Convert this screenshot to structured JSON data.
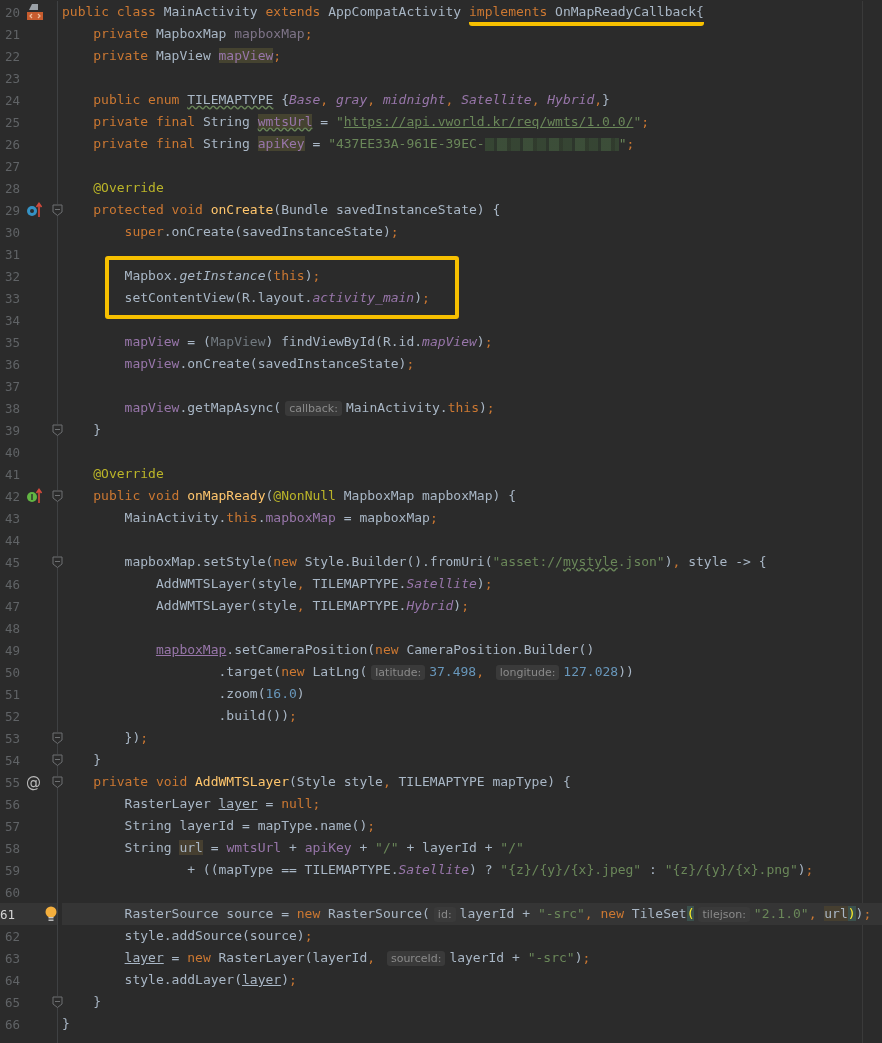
{
  "editor": {
    "lines": [
      {
        "number": "20",
        "gutter": {
          "kind": "file"
        },
        "tokens": [
          {
            "kind": "kw",
            "text": "public class "
          },
          {
            "kind": "plain",
            "text": "MainActivity "
          },
          {
            "kind": "kw",
            "text": "extends "
          },
          {
            "kind": "plain",
            "text": "AppCompatActivity "
          },
          {
            "kind": "marked",
            "tokens": [
              {
                "kind": "kw",
                "text": "implements"
              },
              {
                "kind": "plain",
                "text": " OnMapReadyCallback{"
              }
            ]
          }
        ],
        "children": [
          {
            "number": "21",
            "tokens": [
              {
                "kind": "kw",
                "text": "private "
              },
              {
                "kind": "plain",
                "text": "MapboxMap "
              },
              {
                "kind": "unused",
                "text": "mapboxMap"
              },
              {
                "kind": "kw",
                "text": ";"
              }
            ]
          },
          {
            "number": "22",
            "tokens": [
              {
                "kind": "kw",
                "text": "private "
              },
              {
                "kind": "plain",
                "text": "MapView "
              },
              {
                "kind": "fieldbg",
                "text": "mapView"
              },
              {
                "kind": "kw",
                "text": ";"
              }
            ]
          },
          {
            "number": "23"
          },
          {
            "number": "24",
            "tokens": [
              {
                "kind": "kw",
                "text": "public enum "
              },
              {
                "kind": "wavy",
                "text": "TILEMAPTYPE"
              },
              {
                "kind": "plain",
                "text": " {"
              },
              {
                "kind": "field_i",
                "text": "Base"
              },
              {
                "kind": "kw",
                "text": ", "
              },
              {
                "kind": "field_i",
                "text": "gray"
              },
              {
                "kind": "kw",
                "text": ", "
              },
              {
                "kind": "field_i",
                "text": "midnight"
              },
              {
                "kind": "kw",
                "text": ", "
              },
              {
                "kind": "field_i",
                "text": "Satellite"
              },
              {
                "kind": "kw",
                "text": ", "
              },
              {
                "kind": "field_i",
                "text": "Hybrid"
              },
              {
                "kind": "kw",
                "text": ","
              },
              {
                "kind": "plain",
                "text": "}"
              }
            ]
          },
          {
            "number": "25",
            "tokens": [
              {
                "kind": "kw",
                "text": "private final "
              },
              {
                "kind": "plain",
                "text": "String "
              },
              {
                "kind": "fieldbg_wavy",
                "text": "wmtsUrl"
              },
              {
                "kind": "plain",
                "text": " = "
              },
              {
                "kind": "str",
                "text": "\""
              },
              {
                "kind": "strurl",
                "text": "https://api.vworld.kr/req/wmts/1.0.0/"
              },
              {
                "kind": "str",
                "text": "\""
              },
              {
                "kind": "kw",
                "text": ";"
              }
            ]
          },
          {
            "number": "26",
            "tokens": [
              {
                "kind": "kw",
                "text": "private final "
              },
              {
                "kind": "plain",
                "text": "String "
              },
              {
                "kind": "fieldbg",
                "text": "apiKey"
              },
              {
                "kind": "plain",
                "text": " = "
              },
              {
                "kind": "str",
                "text": "\"437EE33A-961E-39EC-"
              },
              {
                "kind": "redacted"
              },
              {
                "kind": "str",
                "text": "\""
              },
              {
                "kind": "kw",
                "text": ";"
              }
            ]
          },
          {
            "number": "27"
          },
          {
            "number": "28",
            "tokens": [
              {
                "kind": "ann",
                "text": "@Override"
              }
            ]
          },
          {
            "number": "29",
            "gutter": {
              "kind": "override"
            },
            "fold": true,
            "tokens": [
              {
                "kind": "kw",
                "text": "protected void "
              },
              {
                "kind": "fn",
                "text": "onCreate"
              },
              {
                "kind": "plain",
                "text": "(Bundle savedInstanceState) {"
              }
            ],
            "children": [
              {
                "number": "30",
                "tokens": [
                  {
                    "kind": "kw",
                    "text": "super"
                  },
                  {
                    "kind": "plain",
                    "text": ".onCreate(savedInstanceState)"
                  },
                  {
                    "kind": "kw",
                    "text": ";"
                  }
                ]
              },
              {
                "number": "31"
              },
              {
                "number": "32",
                "boxed": true,
                "tokens": [
                  {
                    "kind": "plain",
                    "text": "Mapbox."
                  },
                  {
                    "kind": "static_i",
                    "text": "getInstance"
                  },
                  {
                    "kind": "plain",
                    "text": "("
                  },
                  {
                    "kind": "kw",
                    "text": "this"
                  },
                  {
                    "kind": "plain",
                    "text": ")"
                  },
                  {
                    "kind": "kw",
                    "text": ";"
                  }
                ]
              },
              {
                "number": "33",
                "boxed": true,
                "tokens": [
                  {
                    "kind": "plain",
                    "text": "setContentView(R.layout."
                  },
                  {
                    "kind": "field_i",
                    "text": "activity_main"
                  },
                  {
                    "kind": "plain",
                    "text": ")"
                  },
                  {
                    "kind": "kw",
                    "text": ";"
                  }
                ]
              },
              {
                "number": "34"
              },
              {
                "number": "35",
                "tokens": [
                  {
                    "kind": "field",
                    "text": "mapView"
                  },
                  {
                    "kind": "plain",
                    "text": " = ("
                  },
                  {
                    "kind": "gray",
                    "text": "MapView"
                  },
                  {
                    "kind": "plain",
                    "text": ") findViewById(R.id."
                  },
                  {
                    "kind": "field_i",
                    "text": "mapView"
                  },
                  {
                    "kind": "plain",
                    "text": ")"
                  },
                  {
                    "kind": "kw",
                    "text": ";"
                  }
                ]
              },
              {
                "number": "36",
                "tokens": [
                  {
                    "kind": "field",
                    "text": "mapView"
                  },
                  {
                    "kind": "plain",
                    "text": ".onCreate(savedInstanceState)"
                  },
                  {
                    "kind": "kw",
                    "text": ";"
                  }
                ]
              },
              {
                "number": "37"
              },
              {
                "number": "38",
                "tokens": [
                  {
                    "kind": "field",
                    "text": "mapView"
                  },
                  {
                    "kind": "plain",
                    "text": ".getMapAsync("
                  },
                  {
                    "kind": "hint",
                    "text": "callback:"
                  },
                  {
                    "kind": "plain",
                    "text": "MainActivity."
                  },
                  {
                    "kind": "kw",
                    "text": "this"
                  },
                  {
                    "kind": "plain",
                    "text": ")"
                  },
                  {
                    "kind": "kw",
                    "text": ";"
                  }
                ]
              }
            ]
          },
          {
            "number": "39",
            "fold": true,
            "tokens": [
              {
                "kind": "plain",
                "text": "}"
              }
            ]
          },
          {
            "number": "40"
          },
          {
            "number": "41",
            "tokens": [
              {
                "kind": "ann",
                "text": "@Override"
              }
            ]
          },
          {
            "number": "42",
            "gutter": {
              "kind": "implement"
            },
            "fold": true,
            "tokens": [
              {
                "kind": "kw",
                "text": "public void "
              },
              {
                "kind": "fn",
                "text": "onMapReady"
              },
              {
                "kind": "plain",
                "text": "("
              },
              {
                "kind": "ann",
                "text": "@NonNull"
              },
              {
                "kind": "plain",
                "text": " MapboxMap mapboxMap) {"
              }
            ],
            "children": [
              {
                "number": "43",
                "tokens": [
                  {
                    "kind": "plain",
                    "text": "MainActivity."
                  },
                  {
                    "kind": "kw",
                    "text": "this"
                  },
                  {
                    "kind": "plain",
                    "text": "."
                  },
                  {
                    "kind": "field",
                    "text": "mapboxMap"
                  },
                  {
                    "kind": "plain",
                    "text": " = mapboxMap"
                  },
                  {
                    "kind": "kw",
                    "text": ";"
                  }
                ]
              },
              {
                "number": "44"
              },
              {
                "number": "45",
                "fold": true,
                "tokens": [
                  {
                    "kind": "plain",
                    "text": "mapboxMap.setStyle("
                  },
                  {
                    "kind": "kw",
                    "text": "new "
                  },
                  {
                    "kind": "plain",
                    "text": "Style.Builder().fromUri("
                  },
                  {
                    "kind": "str",
                    "text": "\"asset://"
                  },
                  {
                    "kind": "strwavy",
                    "text": "mystyle"
                  },
                  {
                    "kind": "str",
                    "text": ".json\""
                  },
                  {
                    "kind": "plain",
                    "text": ")"
                  },
                  {
                    "kind": "kw",
                    "text": ", "
                  },
                  {
                    "kind": "plain",
                    "text": "style -> {"
                  }
                ],
                "children": [
                  {
                    "number": "46",
                    "tokens": [
                      {
                        "kind": "plain",
                        "text": "AddWMTSLayer(style"
                      },
                      {
                        "kind": "kw",
                        "text": ", "
                      },
                      {
                        "kind": "plain",
                        "text": "TILEMAPTYPE."
                      },
                      {
                        "kind": "field_i",
                        "text": "Satellite"
                      },
                      {
                        "kind": "plain",
                        "text": ")"
                      },
                      {
                        "kind": "kw",
                        "text": ";"
                      }
                    ]
                  },
                  {
                    "number": "47",
                    "tokens": [
                      {
                        "kind": "plain",
                        "text": "AddWMTSLayer(style"
                      },
                      {
                        "kind": "kw",
                        "text": ", "
                      },
                      {
                        "kind": "plain",
                        "text": "TILEMAPTYPE."
                      },
                      {
                        "kind": "field_i",
                        "text": "Hybrid"
                      },
                      {
                        "kind": "plain",
                        "text": ")"
                      },
                      {
                        "kind": "kw",
                        "text": ";"
                      }
                    ]
                  },
                  {
                    "number": "48"
                  },
                  {
                    "number": "49",
                    "tokens": [
                      {
                        "kind": "fieldunder",
                        "text": "mapboxMap"
                      },
                      {
                        "kind": "plain",
                        "text": ".setCameraPosition("
                      },
                      {
                        "kind": "kw",
                        "text": "new "
                      },
                      {
                        "kind": "plain",
                        "text": "CameraPosition.Builder()"
                      }
                    ],
                    "continued": [
                      {
                        "number": "50",
                        "tokens": [
                          {
                            "kind": "plain",
                            "text": ".target("
                          },
                          {
                            "kind": "kw",
                            "text": "new "
                          },
                          {
                            "kind": "plain",
                            "text": "LatLng("
                          },
                          {
                            "kind": "hint",
                            "text": "latitude:"
                          },
                          {
                            "kind": "num",
                            "text": "37.498"
                          },
                          {
                            "kind": "kw",
                            "text": ", "
                          },
                          {
                            "kind": "hint",
                            "text": "longitude:"
                          },
                          {
                            "kind": "num",
                            "text": "127.028"
                          },
                          {
                            "kind": "plain",
                            "text": "))"
                          }
                        ]
                      },
                      {
                        "number": "51",
                        "tokens": [
                          {
                            "kind": "plain",
                            "text": ".zoom("
                          },
                          {
                            "kind": "num",
                            "text": "16.0"
                          },
                          {
                            "kind": "plain",
                            "text": ")"
                          }
                        ]
                      },
                      {
                        "number": "52",
                        "tokens": [
                          {
                            "kind": "plain",
                            "text": ".build())"
                          },
                          {
                            "kind": "kw",
                            "text": ";"
                          }
                        ]
                      }
                    ]
                  }
                ]
              },
              {
                "number": "53",
                "fold": true,
                "tokens": [
                  {
                    "kind": "plain",
                    "text": "})"
                  },
                  {
                    "kind": "kw",
                    "text": ";"
                  }
                ]
              }
            ]
          },
          {
            "number": "54",
            "fold": true,
            "tokens": [
              {
                "kind": "plain",
                "text": "}"
              }
            ]
          },
          {
            "number": "55",
            "gutter": {
              "kind": "at",
              "text": "@"
            },
            "fold": true,
            "tokens": [
              {
                "kind": "kw",
                "text": "private void "
              },
              {
                "kind": "fn",
                "text": "AddWMTSLayer"
              },
              {
                "kind": "plain",
                "text": "(Style style"
              },
              {
                "kind": "kw",
                "text": ", "
              },
              {
                "kind": "plain",
                "text": "TILEMAPTYPE mapType) {"
              }
            ],
            "children": [
              {
                "number": "56",
                "tokens": [
                  {
                    "kind": "plain",
                    "text": "RasterLayer "
                  },
                  {
                    "kind": "under",
                    "text": "layer"
                  },
                  {
                    "kind": "plain",
                    "text": " = "
                  },
                  {
                    "kind": "kw",
                    "text": "null;"
                  }
                ]
              },
              {
                "number": "57",
                "tokens": [
                  {
                    "kind": "plain",
                    "text": "String layerId = mapType.name()"
                  },
                  {
                    "kind": "kw",
                    "text": ";"
                  }
                ]
              },
              {
                "number": "58",
                "tokens": [
                  {
                    "kind": "plain",
                    "text": "String "
                  },
                  {
                    "kind": "plainbg",
                    "text": "url"
                  },
                  {
                    "kind": "plain",
                    "text": " = "
                  },
                  {
                    "kind": "field",
                    "text": "wmtsUrl"
                  },
                  {
                    "kind": "plain",
                    "text": " + "
                  },
                  {
                    "kind": "field",
                    "text": "apiKey"
                  },
                  {
                    "kind": "plain",
                    "text": " + "
                  },
                  {
                    "kind": "str",
                    "text": "\"/\""
                  },
                  {
                    "kind": "plain",
                    "text": " + layerId + "
                  },
                  {
                    "kind": "str",
                    "text": "\"/\""
                  }
                ],
                "continued": [
                  {
                    "number": "59",
                    "tokens": [
                      {
                        "kind": "plain",
                        "text": "+ ((mapType == TILEMAPTYPE."
                      },
                      {
                        "kind": "field_i",
                        "text": "Satellite"
                      },
                      {
                        "kind": "plain",
                        "text": ") ? "
                      },
                      {
                        "kind": "str",
                        "text": "\"{z}/{y}/{x}.jpeg\""
                      },
                      {
                        "kind": "plain",
                        "text": " : "
                      },
                      {
                        "kind": "str",
                        "text": "\"{z}/{y}/{x}.png\""
                      },
                      {
                        "kind": "plain",
                        "text": ")"
                      },
                      {
                        "kind": "kw",
                        "text": ";"
                      }
                    ]
                  }
                ]
              },
              {
                "number": "60"
              },
              {
                "number": "61",
                "gutter": {
                  "kind": "bulb"
                },
                "current": true,
                "tokens": [
                  {
                    "kind": "plain",
                    "text": "RasterSource source = "
                  },
                  {
                    "kind": "kw",
                    "text": "new "
                  },
                  {
                    "kind": "plain",
                    "text": "RasterSource("
                  },
                  {
                    "kind": "hint",
                    "text": "id:"
                  },
                  {
                    "kind": "plain",
                    "text": "layerId + "
                  },
                  {
                    "kind": "str",
                    "text": "\"-src\""
                  },
                  {
                    "kind": "kw",
                    "text": ", new "
                  },
                  {
                    "kind": "plain",
                    "text": "TileSet"
                  },
                  {
                    "kind": "brace",
                    "text": "("
                  },
                  {
                    "kind": "hint",
                    "text": "tilejson:"
                  },
                  {
                    "kind": "str",
                    "text": "\"2.1.0\""
                  },
                  {
                    "kind": "kw",
                    "text": ", "
                  },
                  {
                    "kind": "plainbg",
                    "text": "url"
                  },
                  {
                    "kind": "brace",
                    "text": ")"
                  },
                  {
                    "kind": "plain",
                    "text": ")"
                  },
                  {
                    "kind": "kw",
                    "text": ";"
                  }
                ]
              },
              {
                "number": "62",
                "tokens": [
                  {
                    "kind": "plain",
                    "text": "style.addSource(source)"
                  },
                  {
                    "kind": "kw",
                    "text": ";"
                  }
                ]
              },
              {
                "number": "63",
                "tokens": [
                  {
                    "kind": "under",
                    "text": "layer"
                  },
                  {
                    "kind": "plain",
                    "text": " = "
                  },
                  {
                    "kind": "kw",
                    "text": "new "
                  },
                  {
                    "kind": "plain",
                    "text": "RasterLayer(layerId"
                  },
                  {
                    "kind": "kw",
                    "text": ", "
                  },
                  {
                    "kind": "hint",
                    "text": "sourceId:"
                  },
                  {
                    "kind": "plain",
                    "text": "layerId + "
                  },
                  {
                    "kind": "str",
                    "text": "\"-src\""
                  },
                  {
                    "kind": "plain",
                    "text": ")"
                  },
                  {
                    "kind": "kw",
                    "text": ";"
                  }
                ]
              },
              {
                "number": "64",
                "tokens": [
                  {
                    "kind": "plain",
                    "text": "style.addLayer("
                  },
                  {
                    "kind": "under",
                    "text": "layer"
                  },
                  {
                    "kind": "plain",
                    "text": ")"
                  },
                  {
                    "kind": "kw",
                    "text": ";"
                  }
                ]
              }
            ]
          },
          {
            "number": "65",
            "fold": true,
            "tokens": [
              {
                "kind": "plain",
                "text": "}"
              }
            ]
          }
        ]
      },
      {
        "number": "66",
        "tokens": [
          {
            "kind": "plain",
            "text": "}"
          }
        ]
      }
    ]
  }
}
